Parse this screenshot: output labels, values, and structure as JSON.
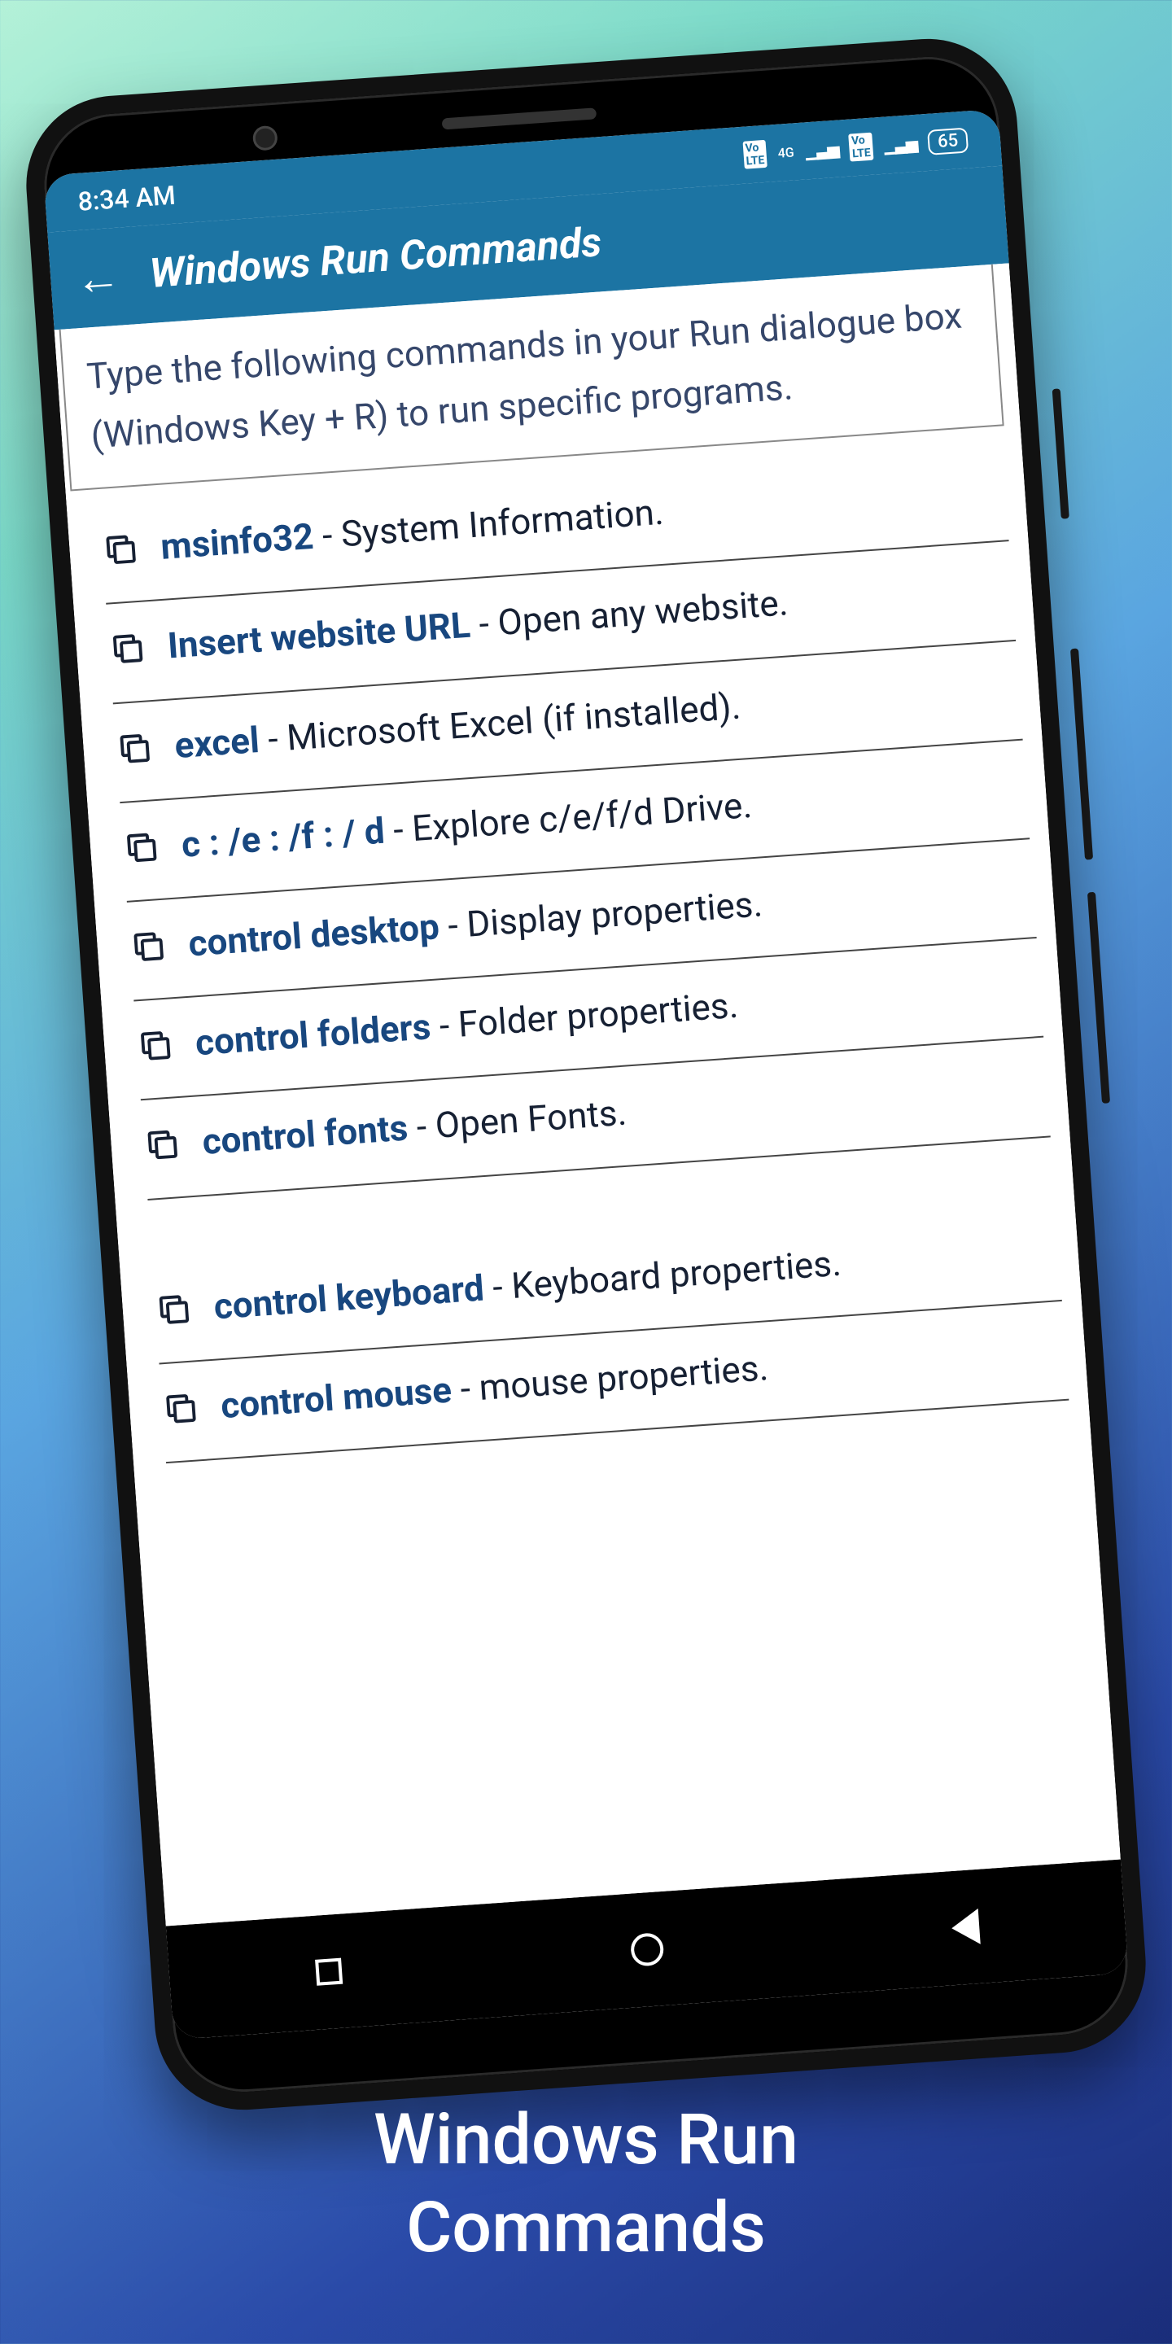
{
  "statusbar": {
    "time": "8:34 AM",
    "battery": "65",
    "net": "4G"
  },
  "appbar": {
    "title": "Windows Run Commands"
  },
  "intro": "Type the following commands in your Run dialogue box (Windows Key + R) to run specific programs.",
  "commands": [
    {
      "cmd": "msinfo32",
      "desc": "System Information."
    },
    {
      "cmd": "Insert website URL",
      "desc": "Open any website."
    },
    {
      "cmd": "excel",
      "desc": "Microsoft Excel (if installed)."
    },
    {
      "cmd": "c : /e : /f : / d",
      "desc": "Explore c/e/f/d Drive."
    },
    {
      "cmd": "control desktop",
      "desc": "Display properties."
    },
    {
      "cmd": "control folders",
      "desc": "Folder properties."
    },
    {
      "cmd": "control fonts",
      "desc": "Open Fonts."
    },
    {
      "cmd": "control keyboard",
      "desc": "Keyboard properties."
    },
    {
      "cmd": "control mouse",
      "desc": "mouse properties."
    }
  ],
  "promo": {
    "line1": "Windows Run",
    "line2": "Commands"
  }
}
